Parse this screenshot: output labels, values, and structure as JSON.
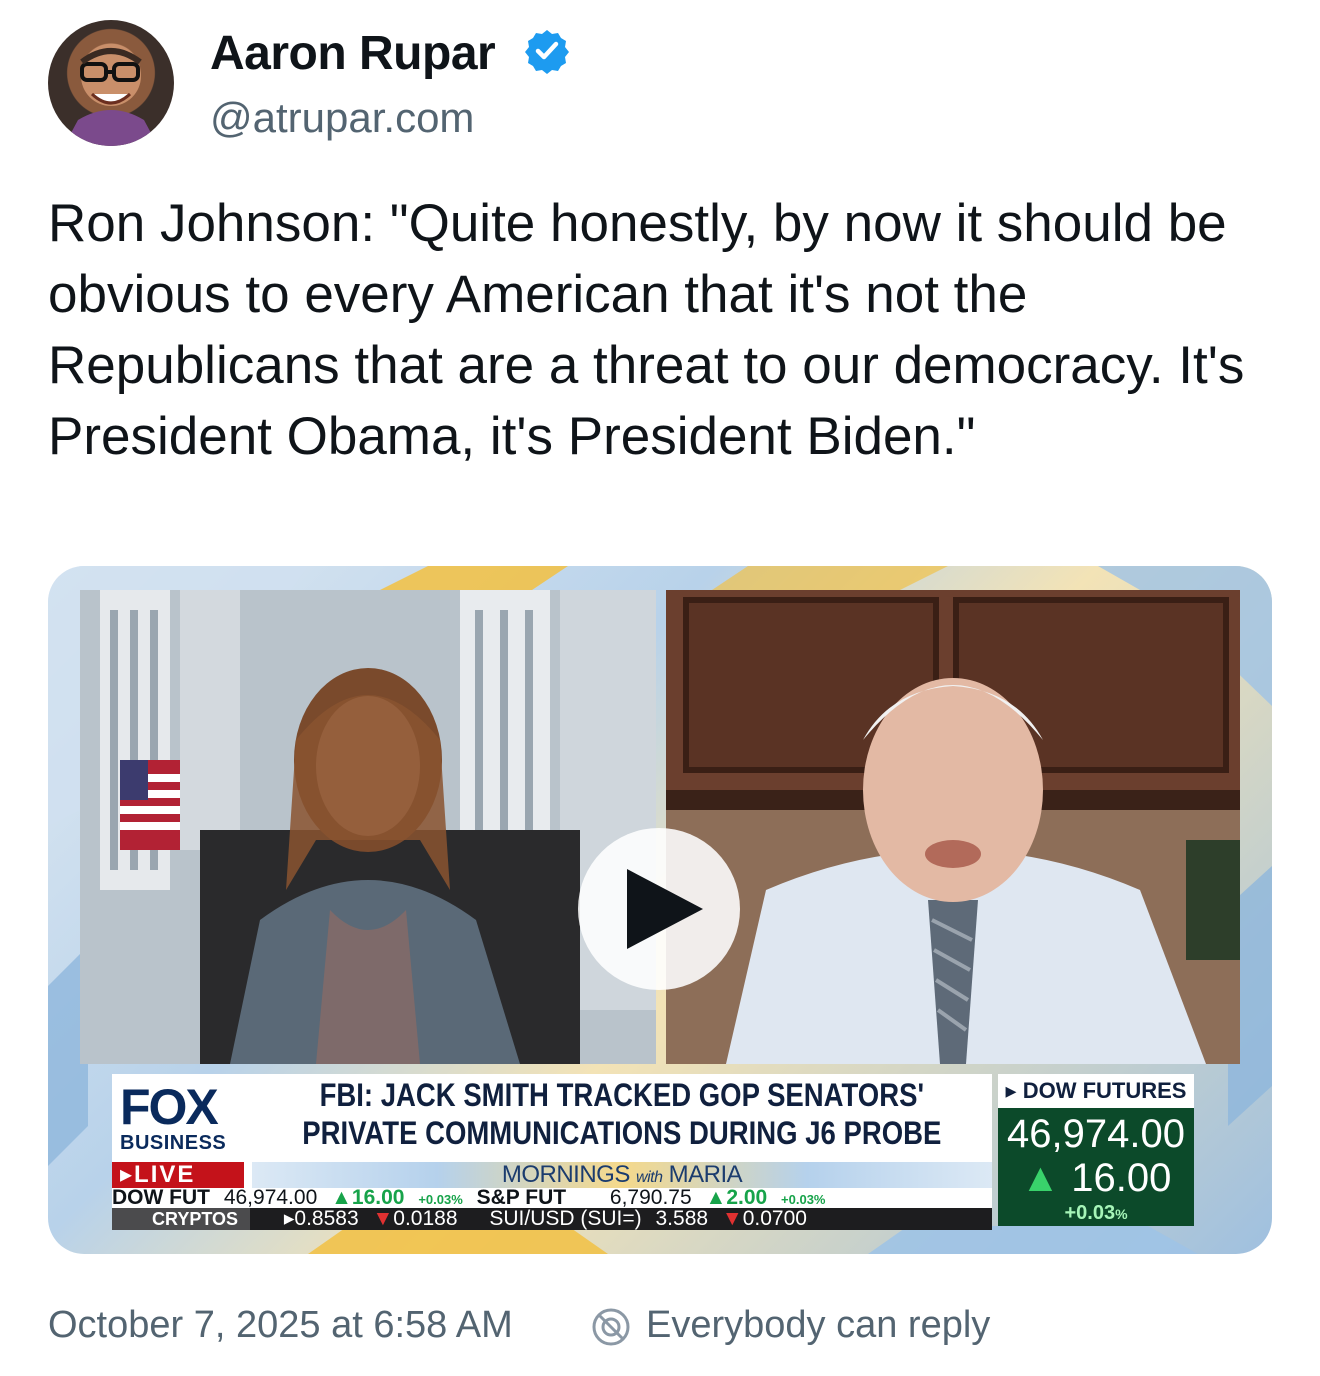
{
  "author": {
    "display_name": "Aaron Rupar",
    "handle": "@atrupar.com",
    "verified_icon": "verified-badge-icon",
    "verified_color": "#1d9bf0"
  },
  "post": {
    "text": "Ron Johnson: \"Quite honestly, by now it should be obvious to every American that it's not the Republicans that are a threat to our democracy. It's President Obama, it's President Biden.\"",
    "timestamp": "October 7, 2025 at 6:58 AM",
    "reply_setting": "Everybody can reply",
    "reply_icon": "everybody-reply-icon"
  },
  "video": {
    "play_icon": "play-icon",
    "logo_main": "FOX",
    "logo_sub": "BUSINESS",
    "live_label": "LIVE",
    "headline_line1": "FBI: JACK SMITH TRACKED GOP SENATORS'",
    "headline_line2": "PRIVATE COMMUNICATIONS DURING J6 PROBE",
    "show_name_a": "MORNINGS",
    "show_name_b": "with",
    "show_name_c": "MARIA",
    "ticker_top": {
      "dow_label": "DOW FUT",
      "dow_value": "46,974.00",
      "dow_change": "16.00",
      "dow_pct": "+0.03%",
      "sp_label": "S&P FUT",
      "sp_value": "6,790.75",
      "sp_change": "2.00",
      "sp_pct": "+0.03%"
    },
    "ticker_bottom": {
      "label": "CRYPTOS",
      "v1": "0.8583",
      "c1": "0.0188",
      "sym": "SUI/USD (SUI=)",
      "v2": "3.588",
      "c2": "0.0700"
    },
    "futures": {
      "title": "DOW FUTURES",
      "value": "46,974.00",
      "change": "16.00",
      "pct": "+0.03",
      "pct_sign": "%"
    }
  }
}
